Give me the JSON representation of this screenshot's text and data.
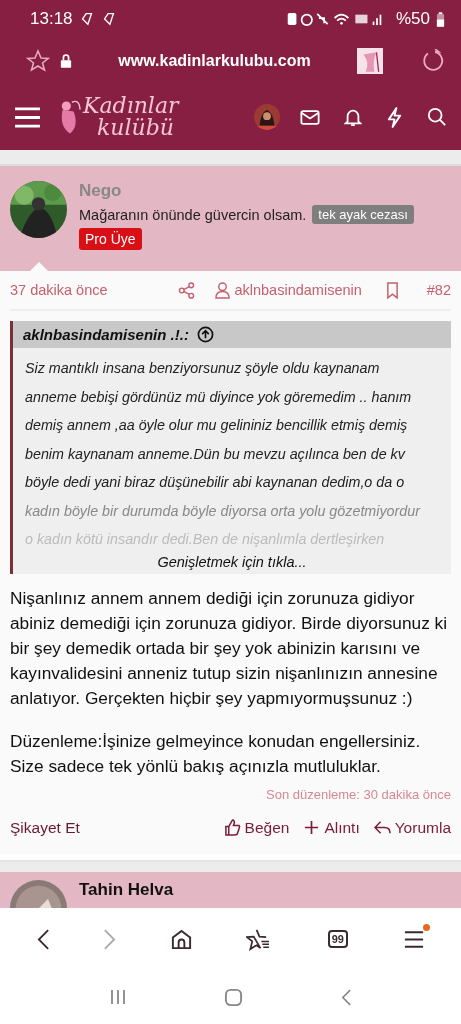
{
  "status_bar": {
    "time": "13:18",
    "battery": "%50"
  },
  "address_bar": {
    "url": "www.kadinlarkulubu.com"
  },
  "site_header": {
    "logo_line_1": "Kadınlar",
    "logo_line_2": "kulübü"
  },
  "post": {
    "author": "Nego",
    "signature": "Mağaranın önünde güvercin olsam.",
    "title_badge": "tek ayak cezası",
    "rank_badge": "Pro Üye",
    "time": "37 dakika önce",
    "quoted_user": "aklnbasindamisenin",
    "post_number": "#82",
    "quote": {
      "author": "aklnbasindamisenin .!.:",
      "lines": [
        "Siz mantıklı insana benziyorsunuz şöyle oldu kaynanam",
        "anneme bebişi gördünüz mü diyince yok göremedim .. hanım",
        "demiş annem ,aa öyle olur mu gelininiz bencillik etmiş demiş",
        "benim kaynanam anneme.Dün bu mevzu açılınca ben de kv",
        "böyle dedi yani biraz düşünebilir abi kaynanan dedim,o da o",
        "kadın böyle bir durumda böyle diyorsa orta yolu gözetmiyordur",
        "o kadın kötü insandır dedi.Ben de nişanlımla dertleşirken"
      ],
      "expand": "Genişletmek için tıkla..."
    },
    "paragraphs": [
      "Nişanlınız annem annem dediği için zorunuza gidiyor abiniz demediği için zorunuza gidiyor. Birde diyorsunuz ki bir şey demedik ortada bir şey yok abinizin karısını ve kayınvalidesini anneniz tutup sizin nişanlınızın annesine anlatıyor. Gerçekten hiçbir şey yapmıyormuşsunuz :)",
      "Düzenleme:İşinize gelmeyince konudan engellersiniz. Size sadece tek yönlü bakış açınızla mutluluklar."
    ],
    "edited": "Son düzenleme: 30 dakika önce",
    "report": "Şikayet Et",
    "actions": [
      {
        "kind": "like",
        "label": "Beğen"
      },
      {
        "kind": "quote",
        "label": "Alıntı"
      },
      {
        "kind": "reply",
        "label": "Yorumla"
      }
    ]
  },
  "next_post": {
    "author": "Tahin Helva"
  },
  "browser_toolbar": {
    "tab_count": "99",
    "menu_badge": true
  }
}
